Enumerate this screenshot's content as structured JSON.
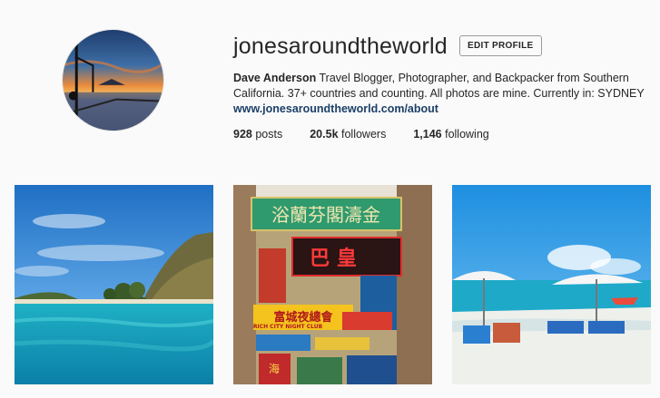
{
  "profile": {
    "username": "jonesaroundtheworld",
    "edit_label": "EDIT PROFILE",
    "full_name": "Dave Anderson",
    "bio": "Travel Blogger, Photographer, and Backpacker from Southern California. 37+ countries and counting. All photos are mine. Currently in: SYDNEY",
    "website": "www.jonesaroundtheworld.com/about"
  },
  "stats": {
    "posts_count": "928",
    "posts_label": "posts",
    "followers_count": "20.5k",
    "followers_label": "followers",
    "following_count": "1,146",
    "following_label": "following"
  },
  "photos": [
    {
      "name": "photo-island-beach"
    },
    {
      "name": "photo-hong-kong-street-signs"
    },
    {
      "name": "photo-beach-umbrellas"
    }
  ],
  "signs": {
    "top_sign": "浴蘭芬閣濤金",
    "red_sign": "巴 皇",
    "yellow_sign": "富城夜總會",
    "night_club": "RICH CITY NIGHT CLUB",
    "lower_sign": "海"
  },
  "colors": {
    "link": "#1c3f67",
    "text": "#262626",
    "background": "#fafafa"
  }
}
